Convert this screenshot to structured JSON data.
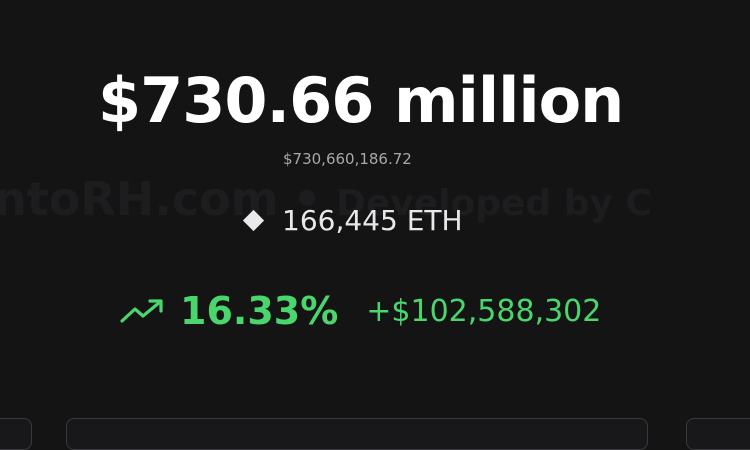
{
  "watermark": {
    "site": "ntoRH.com",
    "separator": "•",
    "credit": "Developed by C"
  },
  "market_value": {
    "headline": "$730.66 million",
    "exact": "$730,660,186.72"
  },
  "holdings": {
    "icon": "ethereum-diamond-icon",
    "amount": "166,445 ETH"
  },
  "performance": {
    "icon": "trending-up-icon",
    "percent": "16.33%",
    "change": "+$102,588,302",
    "color": "#4ad66d"
  }
}
